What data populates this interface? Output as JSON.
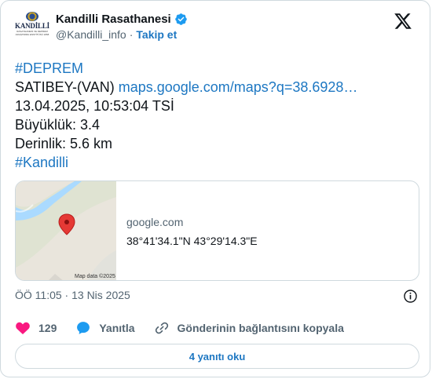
{
  "author": {
    "display_name": "Kandilli Rasathanesi",
    "handle": "@Kandilli_info",
    "separator": "·",
    "follow_label": "Takip et",
    "avatar_text": "KANDİLLİ",
    "avatar_subtext": "RASATHANESİ VE DEPREM ARAŞTIRMA ENSTİTÜSÜ 1868"
  },
  "tweet": {
    "hashtag1": "#DEPREM",
    "location": "SATIBEY-(VAN)",
    "map_link": "maps.google.com/maps?q=38.6928…",
    "datetime": "13.04.2025, 10:53:04 TSİ",
    "magnitude": "Büyüklük: 3.4",
    "depth": "Derinlik: 5.6 km",
    "hashtag2": "#Kandilli"
  },
  "map_card": {
    "domain": "google.com",
    "coords": "38°41'34.1\"N 43°29'14.3\"E",
    "attribution": "Map data ©2025"
  },
  "timestamp": "ÖÖ 11:05 · 13 Nis 2025",
  "actions": {
    "likes": "129",
    "reply_label": "Yanıtla",
    "copy_label": "Gönderinin bağlantısını kopyala"
  },
  "read_replies": "4 yanıtı oku",
  "colors": {
    "link": "#1d77c2",
    "like": "#f91880",
    "reply_icon": "#1d9bf0",
    "verified": "#1d9bf0",
    "border": "#cfd9de",
    "muted": "#536471"
  },
  "icons": {
    "verified": "verified-badge-icon",
    "brand": "x-logo-icon",
    "info": "info-icon",
    "like": "heart-icon",
    "reply": "speech-bubble-icon",
    "copy": "link-icon",
    "map_pin": "map-pin-icon"
  }
}
